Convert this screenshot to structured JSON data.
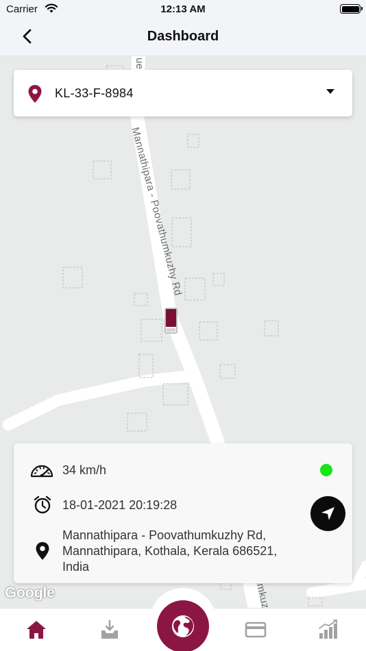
{
  "status_bar": {
    "carrier": "Carrier",
    "time": "12:13 AM",
    "icons": [
      "wifi-icon",
      "battery-icon"
    ]
  },
  "nav": {
    "title": "Dashboard",
    "back_icon": "chevron-left-icon"
  },
  "vehicle_selector": {
    "icon": "map-pin-icon",
    "selected": "KL-33-F-8984",
    "dropdown_icon": "caret-down-icon"
  },
  "map": {
    "road_labels": [
      "Mannathipara - Poovathumkuzhy Rd",
      "Mannathipara - Poovathumkuzhy Rd"
    ],
    "road_label_partial": "ue",
    "attribution": "Google",
    "vehicle_marker_icon": "truck-marker-icon"
  },
  "info": {
    "speed": "34 km/h",
    "timestamp": "18-01-2021 20:19:28",
    "address": "Mannathipara - Poovathumkuzhy Rd, Mannathipara, Kothala, Kerala 686521, India",
    "status_color": "#16e516",
    "icons": [
      "speedometer-icon",
      "alarm-clock-icon",
      "location-pin-icon",
      "navigation-arrow-icon"
    ]
  },
  "tabs": [
    {
      "name": "home",
      "icon": "home-icon",
      "active": true
    },
    {
      "name": "download",
      "icon": "download-tray-icon",
      "active": false
    },
    {
      "name": "map",
      "icon": "globe-icon",
      "active": false
    },
    {
      "name": "payment",
      "icon": "credit-card-icon",
      "active": false
    },
    {
      "name": "reports",
      "icon": "bar-chart-icon",
      "active": false
    }
  ],
  "colors": {
    "brand": "#8c1643",
    "online": "#16e516"
  }
}
